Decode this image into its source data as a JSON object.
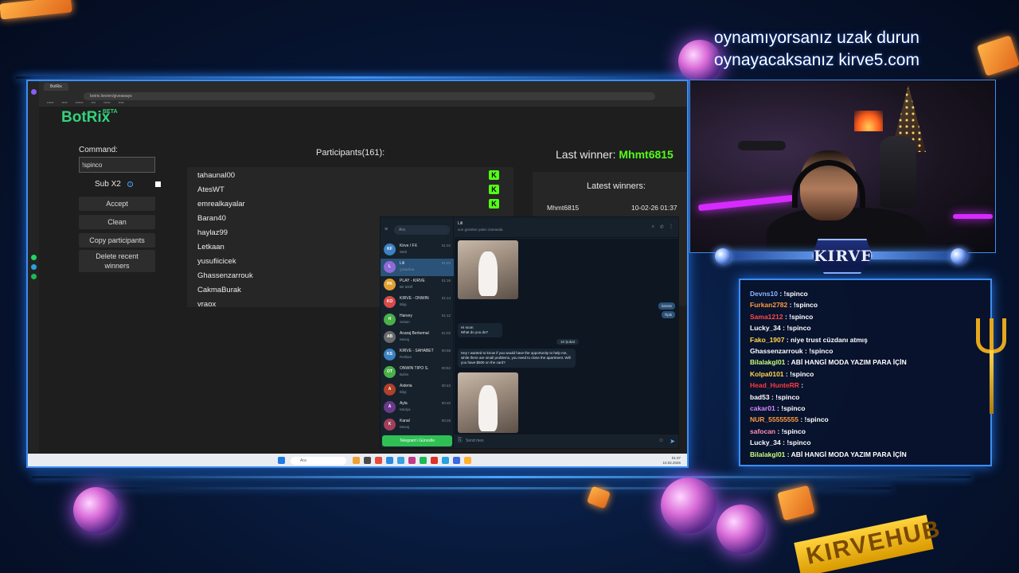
{
  "promo": {
    "line1": "oynamıyorsanız uzak durun",
    "line2": "oynayacaksanız kirve5.com"
  },
  "browser": {
    "tab_label": "BotRix",
    "url": "botrix.live/en/giveaways"
  },
  "botrix": {
    "logo": "BotRix",
    "beta": "BETA",
    "command_label": "Command:",
    "command_value": "!spinco",
    "sub_label": "Sub X2",
    "buttons": {
      "accept": "Accept",
      "clean": "Clean",
      "copy": "Copy participants",
      "delete": "Delete recent winners"
    },
    "participants_title": "Participants(161):",
    "participants": [
      "tahaunal00",
      "AtesWT",
      "emrealkayalar",
      "Baran40",
      "haylaz99",
      "Letkaan",
      "yusufiicicek",
      "Ghassenzarrouk",
      "CakmaBurak",
      "vraox"
    ],
    "kick_icon": "K",
    "last_winner_label": "Last winner:",
    "last_winner_name": "Mhmt6815",
    "latest_winners_title": "Latest winners:",
    "latest_winner": {
      "name": "Mhmt6815",
      "date": "10-02-26 01:37"
    }
  },
  "telegram": {
    "search_placeholder": "Ara",
    "chats": [
      {
        "name": "Kirve / FX",
        "preview": "Web",
        "time": "01:22",
        "initials": "KF",
        "color": "#3b82c4"
      },
      {
        "name": "Lili",
        "preview": "Çıkartma",
        "time": "01:22",
        "initials": "L",
        "color": "#8e6ad8"
      },
      {
        "name": "PLAY - KIRVE",
        "preview": "Bir teklif",
        "time": "01:16",
        "initials": "PK",
        "color": "#e0a030"
      },
      {
        "name": "KIRVE - ONWIN",
        "preview": "Bilgi",
        "time": "01:14",
        "initials": "KO",
        "color": "#d94a4a"
      },
      {
        "name": "Harvey",
        "preview": "Selam",
        "time": "01:12",
        "initials": "H",
        "color": "#4ab04a"
      },
      {
        "name": "Acaraj Berkemal",
        "preview": "Mesaj",
        "time": "01:02",
        "initials": "AB",
        "color": "#6a6a6a"
      },
      {
        "name": "KIRVE - SAHABET",
        "preview": "Reklam",
        "time": "00:58",
        "initials": "KS",
        "color": "#3b82c4"
      },
      {
        "name": "ONWIN TIPO S.",
        "preview": "Bahis",
        "time": "00:52",
        "initials": "OT",
        "color": "#4ab04a"
      },
      {
        "name": "Asteria",
        "preview": "Bilgi",
        "time": "00:43",
        "initials": "A",
        "color": "#b0402a"
      },
      {
        "name": "Ayla",
        "preview": "Medya",
        "time": "00:40",
        "initials": "A",
        "color": "#6a3a8a"
      },
      {
        "name": "Kanal",
        "preview": "Mesaj",
        "time": "00:28",
        "initials": "K",
        "color": "#a0405a"
      }
    ],
    "open_button": "Telegram'ı Güncelle",
    "header_name": "Lili",
    "header_status": "son görülme yakın zamanda",
    "msg_out_1": "kimsin",
    "msg_out_2": "Tipik",
    "msg_in_1": "Hi mom",
    "msg_in_2": "What do you do?",
    "date_label": "10 Şubat",
    "msg_in_3": "Hey I wanted to know if you would have the opportunity to help me, while there are small problems, you need to close the apartment. Will you have $500 on the card?",
    "compose_placeholder": "Send mes"
  },
  "taskbar": {
    "search": "Ara",
    "time": "01:37",
    "date": "10.02.2026"
  },
  "overlay": {
    "logo": "KIRVE"
  },
  "chat": [
    {
      "user": "Devns10",
      "msg": "!spinco",
      "color": "#8fb6ff"
    },
    {
      "user": "Furkan2782",
      "msg": "!spinco",
      "color": "#ff9a3c"
    },
    {
      "user": "Sama1212",
      "msg": "!spinco",
      "color": "#ff4a4a"
    },
    {
      "user": "Lucky_34",
      "msg": "!spinco",
      "color": "#ffffff"
    },
    {
      "user": "Fako_1907",
      "msg": "niye trust cüzdanı atmış",
      "color": "#ffd84a"
    },
    {
      "user": "Ghassenzarrouk",
      "msg": "!spinco",
      "color": "#ffffff"
    },
    {
      "user": "Bilalakgl01",
      "msg": "ABİ HANGİ MODA YAZIM PARA İÇİN",
      "color": "#c8ff7a"
    },
    {
      "user": "Kolpa0101",
      "msg": "!spinco",
      "color": "#ffd84a"
    },
    {
      "user": "Head_HunteRR",
      "msg": "",
      "color": "#ff3a3a"
    },
    {
      "user": "bad53",
      "msg": "!spinco",
      "color": "#ffffff"
    },
    {
      "user": "cakar01",
      "msg": "!spinco",
      "color": "#d68aff"
    },
    {
      "user": "NUR_55555555",
      "msg": "!spinco",
      "color": "#ff9a3c"
    },
    {
      "user": "safocan",
      "msg": "!spinco",
      "color": "#ff8fb0"
    },
    {
      "user": "Lucky_34",
      "msg": "!spinco",
      "color": "#ffffff"
    },
    {
      "user": "Bilalakgl01",
      "msg": "ABİ HANGİ MODA YAZIM PARA İÇİN",
      "color": "#c8ff7a"
    }
  ],
  "decor": {
    "banner_text": "KIRVEHUB"
  }
}
